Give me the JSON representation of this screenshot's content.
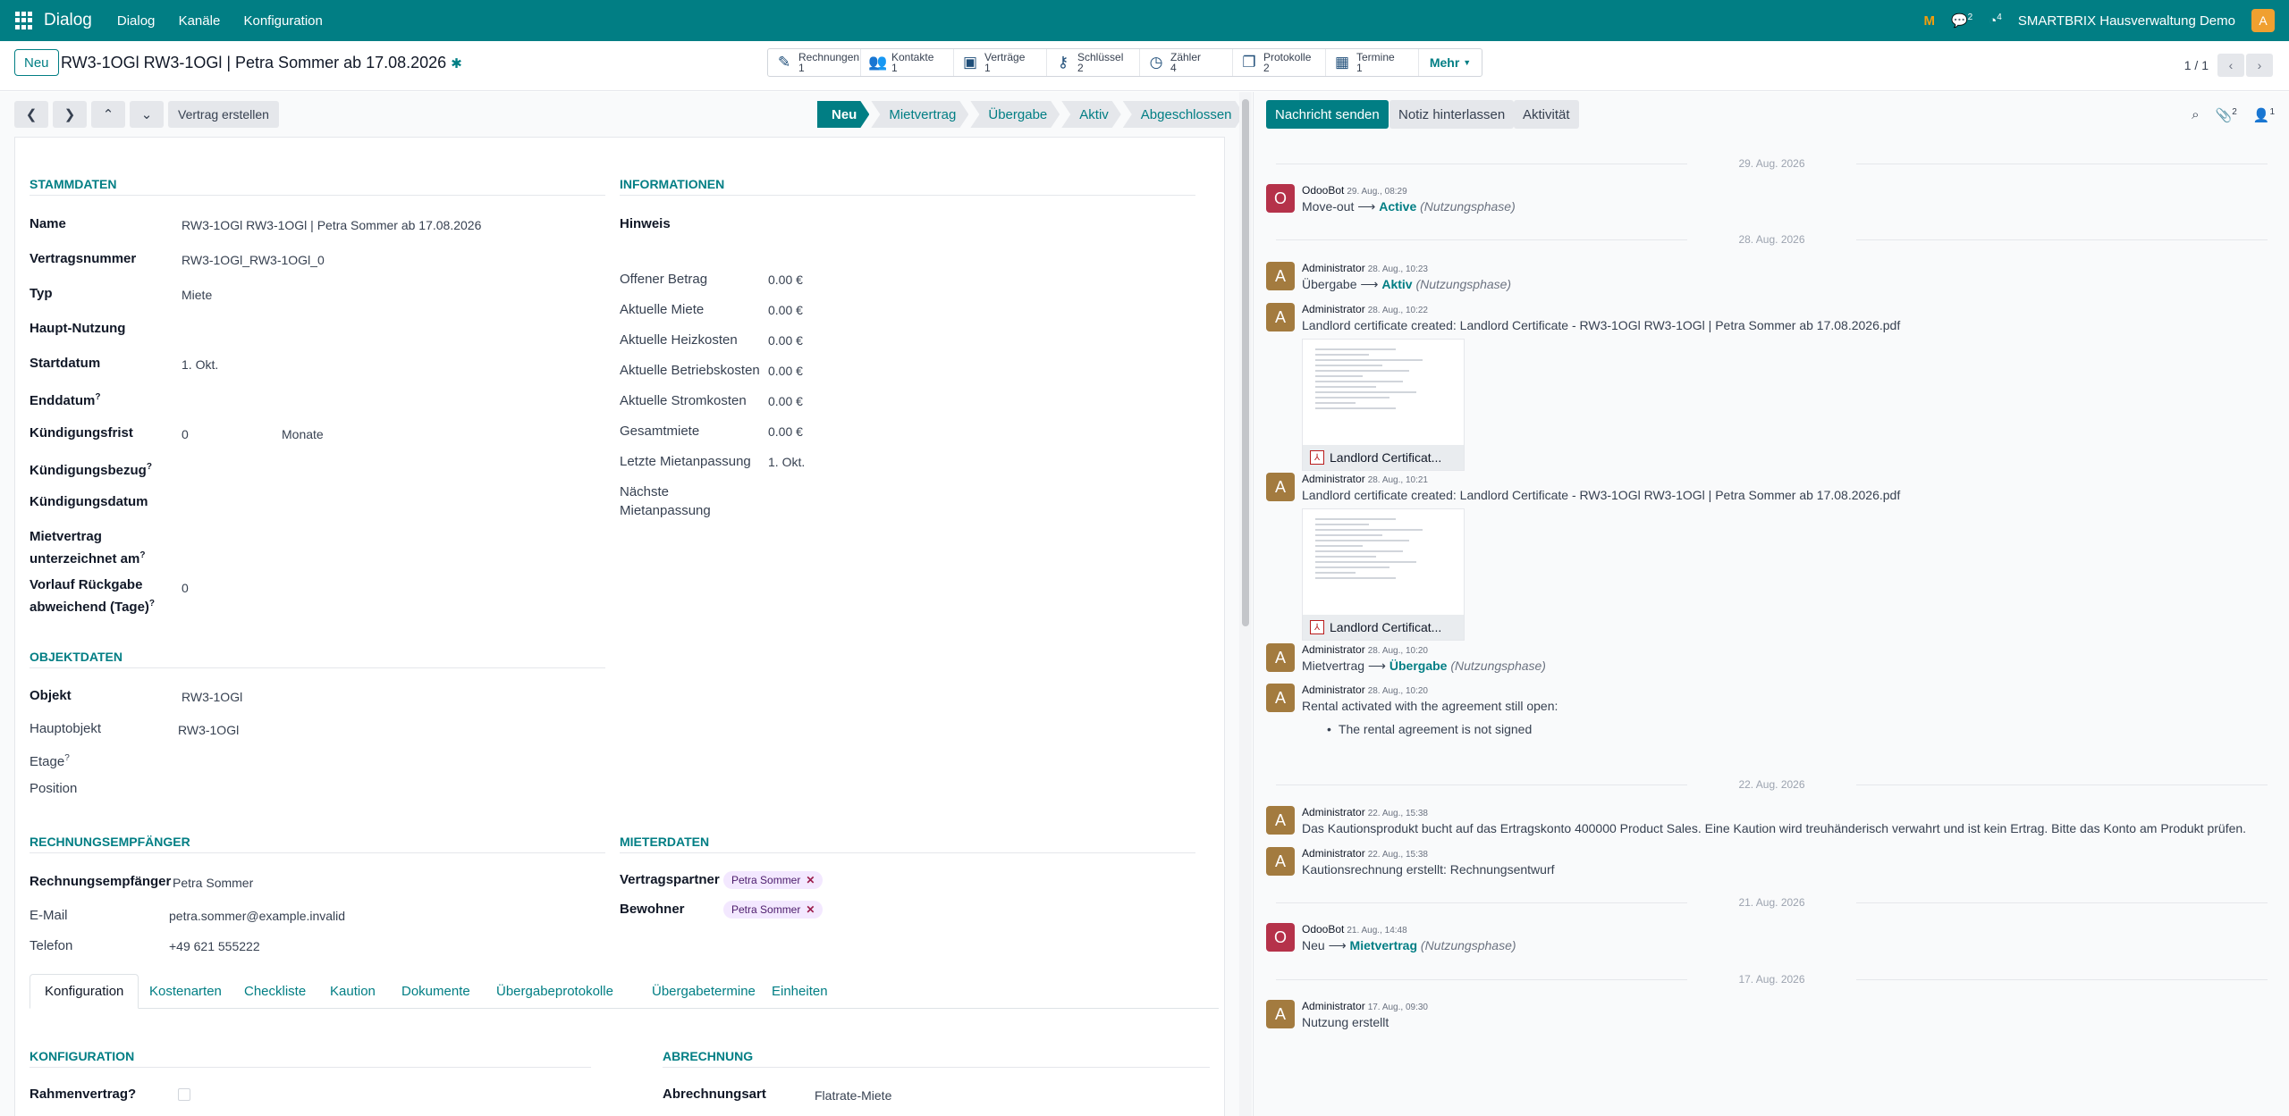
{
  "topbar": {
    "app_name": "Dialog",
    "menu": [
      "Dialog",
      "Kanäle",
      "Konfiguration"
    ],
    "chat_count": "2",
    "activity_count": "4",
    "company": "SMARTBRIX Hausverwaltung Demo",
    "user_initial": "A"
  },
  "control": {
    "new_label": "Neu",
    "record_title": "RW3-1OGl RW3-1OGl | Petra Sommer ab 17.08.2026",
    "smart_buttons": [
      {
        "label": "Rechnungen",
        "count": "1",
        "icon": "invoice-icon"
      },
      {
        "label": "Kontakte",
        "count": "1",
        "icon": "contacts-icon"
      },
      {
        "label": "Verträge",
        "count": "1",
        "icon": "contracts-icon"
      },
      {
        "label": "Schlüssel",
        "count": "2",
        "icon": "key-icon"
      },
      {
        "label": "Zähler",
        "count": "4",
        "icon": "meter-icon"
      },
      {
        "label": "Protokolle",
        "count": "2",
        "icon": "protocol-icon"
      },
      {
        "label": "Termine",
        "count": "1",
        "icon": "calendar-icon"
      }
    ],
    "more_label": "Mehr",
    "pager": "1 / 1"
  },
  "statusbar": {
    "create_contract": "Vertrag erstellen",
    "stages": [
      "Neu",
      "Mietvertrag",
      "Übergabe",
      "Aktiv",
      "Abgeschlossen"
    ],
    "active_stage": "Neu"
  },
  "stammdaten": {
    "title": "STAMMDATEN",
    "name_label": "Name",
    "name_value": "RW3-1OGl RW3-1OGl | Petra Sommer ab 17.08.2026",
    "number_label": "Vertragsnummer",
    "number_value": "RW3-1OGl_RW3-1OGl_0",
    "typ_label": "Typ",
    "typ_value": "Miete",
    "haupt_label": "Haupt-Nutzung",
    "start_label": "Startdatum",
    "start_value": "1. Okt.",
    "end_label": "Enddatum",
    "frist_label": "Kündigungsfrist",
    "frist_value": "0",
    "frist_unit": "Monate",
    "bezug_label": "Kündigungsbezug",
    "kdatum_label": "Kündigungsdatum",
    "signed_label1": "Mietvertrag",
    "signed_label2": "unterzeichnet am",
    "vorlauf_label1": "Vorlauf Rückgabe",
    "vorlauf_label2": "abweichend (Tage)",
    "vorlauf_value": "0",
    "help": "?"
  },
  "informationen": {
    "title": "INFORMATIONEN",
    "hinweis_label": "Hinweis",
    "rows": [
      {
        "label": "Offener Betrag",
        "value": "0.00 €"
      },
      {
        "label": "Aktuelle Miete",
        "value": "0.00 €"
      },
      {
        "label": "Aktuelle Heizkosten",
        "value": "0.00 €"
      },
      {
        "label": "Aktuelle Betriebskosten",
        "value": "0.00 €"
      },
      {
        "label": "Aktuelle Stromkosten",
        "value": "0.00 €"
      },
      {
        "label": "Gesamtmiete",
        "value": "0.00 €"
      },
      {
        "label": "Letzte Mietanpassung",
        "value": "1. Okt."
      }
    ],
    "next_label1": "Nächste",
    "next_label2": "Mietanpassung"
  },
  "objektdaten": {
    "title": "OBJEKTDATEN",
    "objekt_label": "Objekt",
    "objekt_value": "RW3-1OGl",
    "haupt_label": "Hauptobjekt",
    "haupt_value": "RW3-1OGl",
    "etage_label": "Etage",
    "position_label": "Position"
  },
  "rechnung": {
    "title": "RECHNUNGSEMPFÄNGER",
    "empf_label": "Rechnungsempfänger",
    "empf_value": "Petra Sommer",
    "email_label": "E-Mail",
    "email_value": "petra.sommer@example.invalid",
    "tel_label": "Telefon",
    "tel_value": "+49 621 555222"
  },
  "mieter": {
    "title": "MIETERDATEN",
    "partner_label": "Vertragspartner",
    "partner_tag": "Petra Sommer",
    "bewohner_label": "Bewohner",
    "bewohner_tag": "Petra Sommer"
  },
  "tabs": [
    "Konfiguration",
    "Kostenarten",
    "Checkliste",
    "Kaution",
    "Dokumente",
    "Übergabeprotokolle",
    "Übergabetermine",
    "Einheiten"
  ],
  "konfig": {
    "title": "KONFIGURATION",
    "rahmen_label": "Rahmenvertrag?",
    "abr_title": "ABRECHNUNG",
    "abr_label": "Abrechnungsart",
    "abr_value": "Flatrate-Miete"
  },
  "chatter": {
    "send": "Nachricht senden",
    "note": "Notiz hinterlassen",
    "activity": "Aktivität",
    "attach_count": "2",
    "follower_count": "1",
    "dates": [
      "29. Aug. 2026",
      "28. Aug. 2026",
      "22. Aug. 2026",
      "21. Aug. 2026",
      "17. Aug. 2026"
    ],
    "m1": {
      "author": "OdooBot",
      "time": "29. Aug., 08:29",
      "from": "Move-out",
      "to": "Active",
      "field": "(Nutzungsphase)"
    },
    "m2": {
      "author": "Administrator",
      "time": "28. Aug., 10:23",
      "from": "Übergabe",
      "to": "Aktiv",
      "field": "(Nutzungsphase)"
    },
    "m3": {
      "author": "Administrator",
      "time": "28. Aug., 10:22",
      "text": "Landlord certificate created: Landlord Certificate - RW3-1OGl RW3-1OGl | Petra Sommer ab 17.08.2026.pdf",
      "file": "Landlord Certificat..."
    },
    "m4": {
      "author": "Administrator",
      "time": "28. Aug., 10:21",
      "text": "Landlord certificate created: Landlord Certificate - RW3-1OGl RW3-1OGl | Petra Sommer ab 17.08.2026.pdf",
      "file": "Landlord Certificat..."
    },
    "m5": {
      "author": "Administrator",
      "time": "28. Aug., 10:20",
      "from": "Mietvertrag",
      "to": "Übergabe",
      "field": "(Nutzungsphase)"
    },
    "m6": {
      "author": "Administrator",
      "time": "28. Aug., 10:20",
      "text": "Rental activated with the agreement still open:",
      "bullet": "The rental agreement is not signed"
    },
    "m7": {
      "author": "Administrator",
      "time": "22. Aug., 15:38",
      "text": "Das Kautionsprodukt bucht auf das Ertragskonto 400000 Product Sales. Eine Kaution wird treuhänderisch verwahrt und ist kein Ertrag. Bitte das Konto am Produkt prüfen."
    },
    "m8": {
      "author": "Administrator",
      "time": "22. Aug., 15:38",
      "text": "Kautionsrechnung erstellt: Rechnungsentwurf"
    },
    "m9": {
      "author": "OdooBot",
      "time": "21. Aug., 14:48",
      "from": "Neu",
      "to": "Mietvertrag",
      "field": "(Nutzungsphase)"
    },
    "m10": {
      "author": "Administrator",
      "time": "17. Aug., 09:30",
      "text": "Nutzung erstellt"
    },
    "initial_bot": "O",
    "initial_admin": "A",
    "arrow": "⟶",
    "pdf_mark": "⅄"
  },
  "colors": {
    "brand": "#017e84",
    "bot": "#b5324a",
    "admin": "#a37b3f",
    "tag_bg": "#f3e8ff"
  }
}
